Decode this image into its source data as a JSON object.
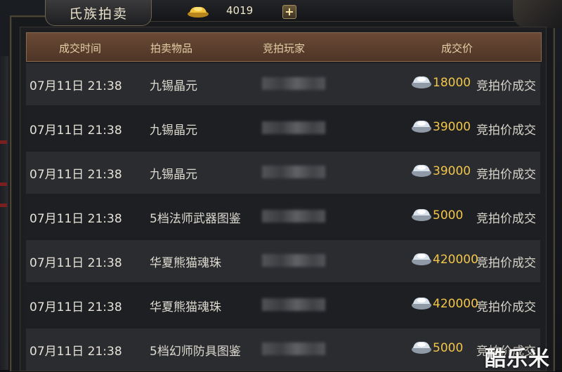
{
  "header": {
    "title": "氏族拍卖",
    "gold_amount": "4019",
    "add_label": "+"
  },
  "columns": {
    "time": "成交时间",
    "item": "拍卖物品",
    "player": "竞拍玩家",
    "price": "成交价"
  },
  "rows": [
    {
      "time": "07月11日 21:38",
      "item": "九锡晶元",
      "price": "18000",
      "result": "竞拍价成交"
    },
    {
      "time": "07月11日 21:38",
      "item": "九锡晶元",
      "price": "39000",
      "result": "竞拍价成交"
    },
    {
      "time": "07月11日 21:38",
      "item": "九锡晶元",
      "price": "39000",
      "result": "竞拍价成交"
    },
    {
      "time": "07月11日 21:38",
      "item": "5档法师武器图鉴",
      "price": "5000",
      "result": "竞拍价成交"
    },
    {
      "time": "07月11日 21:38",
      "item": "华夏熊猫魂珠",
      "price": "420000",
      "result": "竞拍价成交"
    },
    {
      "time": "07月11日 21:38",
      "item": "华夏熊猫魂珠",
      "price": "420000",
      "result": "竞拍价成交"
    },
    {
      "time": "07月11日 21:38",
      "item": "5档幻师防具图鉴",
      "price": "5000",
      "result": "竞拍价成交"
    }
  ],
  "watermark": "酷乐米",
  "colors": {
    "price": "#f3c64a",
    "header_bg": "#5e412f",
    "row_odd": "#2a2c30",
    "row_even": "#1d1f23"
  },
  "icons": {
    "currency": "gold-ingot-icon",
    "price_currency": "silver-ingot-icon"
  }
}
